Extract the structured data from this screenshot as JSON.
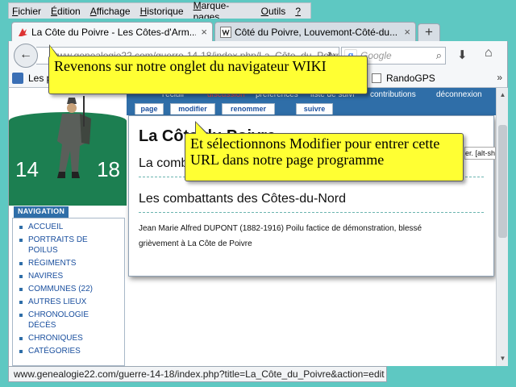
{
  "menubar": {
    "items": [
      {
        "prefix": "",
        "key": "F",
        "rest": "ichier"
      },
      {
        "prefix": "",
        "key": "É",
        "rest": "dition"
      },
      {
        "prefix": "",
        "key": "A",
        "rest": "ffichage"
      },
      {
        "prefix": "",
        "key": "H",
        "rest": "istorique"
      },
      {
        "prefix": "",
        "key": "M",
        "rest": "arque-pages"
      },
      {
        "prefix": "",
        "key": "O",
        "rest": "utils"
      },
      {
        "prefix": "",
        "key": "?",
        "rest": ""
      }
    ]
  },
  "tabs": [
    {
      "label": "La Côte du Poivre - Les Côtes-d'Arm...",
      "close": "×",
      "active": true
    },
    {
      "label": "Côté du Poivre, Louvemont-Côté-du...",
      "close": "×",
      "active": false
    }
  ],
  "newtab_label": "+",
  "navbar": {
    "back_glyph": "←",
    "url_visible": "www.genealogie22.com/guerre-14-18/index.php/La_Côte_du_Poivre",
    "refresh_glyph": "↻",
    "search_engine_glyph": "g",
    "search_placeholder": "Google",
    "search_glyph": "⌕",
    "download_glyph": "⬇",
    "home_glyph": "⌂"
  },
  "bookmarks": {
    "first_label": "Les p",
    "rando_label": "RandoGPS",
    "more_glyph": "»"
  },
  "wiki": {
    "logo_years": [
      "14",
      "18"
    ],
    "nav_heading": "NAVIGATION",
    "nav_items": [
      "ACCUEIL",
      "PORTRAITS DE",
      "POILUS",
      "RÉGIMENTS",
      "NAVIRES",
      "COMMUNES (22)",
      "AUTRES LIEUX",
      "CHRONOLOGIE",
      "DÉCÈS",
      "CHRONIQUES",
      "CATÉGORIES"
    ],
    "personal_links": [
      "l'ecluli",
      "discussion",
      "préférences",
      "liste de suivi",
      "contributions",
      "déconnexion"
    ],
    "page_tabs": [
      "page",
      "modifier",
      "renommer",
      "suivre"
    ],
    "article_title": "La Côte du Poivre",
    "subheading_1": "La combattante",
    "subheading_2": "Les combattants des Côtes-du-Nord",
    "body_text": "Jean Marie Alfred DUPONT (1882-1916) Poilu factice de démonstration, blessé grièvement à La Côte de Poivre",
    "tooltip_hint": "er. [alt-shift-"
  },
  "scrollbar": {
    "up_glyph": "▲",
    "down_glyph": "▼"
  },
  "statusbar_text": "www.genealogie22.com/guerre-14-18/index.php?title=La_Côte_du_Poivre&action=edit",
  "callouts": {
    "callout1": "Revenons sur notre onglet du navigateur WIKI",
    "callout2": "Et sélectionnons Modifier pour entrer cette URL dans notre page programme"
  },
  "colors": {
    "desktop": "#5ec8c2",
    "wiki_bar": "#2f6ea8",
    "logo_green": "#1c7f51",
    "callout_yellow": "#ffff33",
    "link_red": "#ff4a4a"
  }
}
